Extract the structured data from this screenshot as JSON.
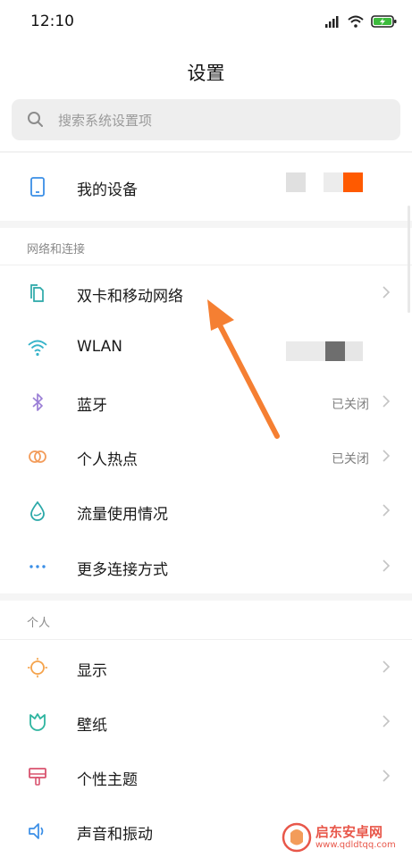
{
  "status_bar": {
    "time": "12:10"
  },
  "header": {
    "title": "设置"
  },
  "search": {
    "placeholder": "搜索系统设置项"
  },
  "my_device": {
    "label": "我的设备"
  },
  "network_section": {
    "header": "网络和连接",
    "items": [
      {
        "label": "双卡和移动网络",
        "value": ""
      },
      {
        "label": "WLAN",
        "value": ""
      },
      {
        "label": "蓝牙",
        "value": "已关闭"
      },
      {
        "label": "个人热点",
        "value": "已关闭"
      },
      {
        "label": "流量使用情况",
        "value": ""
      },
      {
        "label": "更多连接方式",
        "value": ""
      }
    ]
  },
  "personal_section": {
    "header": "个人",
    "items": [
      {
        "label": "显示"
      },
      {
        "label": "壁纸"
      },
      {
        "label": "个性主题"
      },
      {
        "label": "声音和振动"
      }
    ]
  },
  "watermark": {
    "name": "启东安卓网",
    "url": "www.qdldtqq.com"
  },
  "colors": {
    "accent_orange": "#ff5a00",
    "arrow_orange": "#f57f32",
    "wifi_teal": "#36b3c9",
    "bluetooth_purple": "#9b7fd6",
    "hotspot_orange": "#f39c5a",
    "data_teal": "#2aa8a8",
    "more_blue": "#3a8ee6",
    "display_orange": "#f5a34b",
    "wallpaper_teal": "#2fb5a0",
    "theme_pink": "#d9536f",
    "sound_blue": "#3a8ee6",
    "battery_green": "#3dbb3d"
  },
  "icons": {
    "status": [
      "signal-icon",
      "wifi-icon",
      "battery-charging-icon"
    ],
    "search": "search-icon",
    "rows": [
      "phone-icon",
      "dual-sim-icon",
      "wifi-icon",
      "bluetooth-icon",
      "hotspot-icon",
      "data-drop-icon",
      "more-dots-icon",
      "display-sun-icon",
      "wallpaper-tulip-icon",
      "theme-brush-icon",
      "speaker-icon"
    ]
  }
}
